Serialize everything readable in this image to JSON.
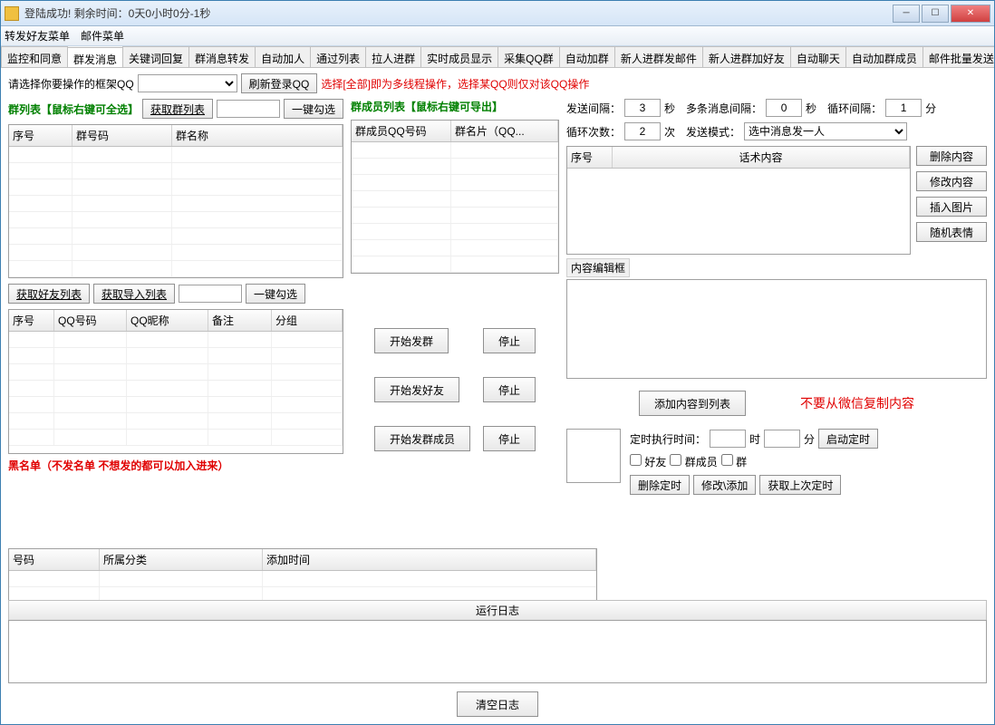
{
  "window": {
    "title": "登陆成功! 剩余时间：0天0小时0分-1秒"
  },
  "menu": {
    "m1": "转发好友菜单",
    "m2": "邮件菜单"
  },
  "tabs": [
    "监控和同意",
    "群发消息",
    "关键词回复",
    "群消息转发",
    "自动加人",
    "通过列表",
    "拉人进群",
    "实时成员显示",
    "采集QQ群",
    "自动加群",
    "新人进群发邮件",
    "新人进群加好友",
    "自动聊天",
    "自动加群成员",
    "邮件批量发送"
  ],
  "top": {
    "label": "请选择你要操作的框架QQ",
    "refresh": "刷新登录QQ",
    "note": "选择[全部]即为多线程操作，选择某QQ则仅对该QQ操作"
  },
  "groupList": {
    "title": "群列表【鼠标右键可全选】",
    "fetch": "获取群列表",
    "checkAll": "一键勾选",
    "cols": {
      "c1": "序号",
      "c2": "群号码",
      "c3": "群名称"
    }
  },
  "memberList": {
    "title": "群成员列表【鼠标右键可导出】",
    "cols": {
      "c1": "群成员QQ号码",
      "c2": "群名片（QQ..."
    }
  },
  "friends": {
    "fetch": "获取好友列表",
    "import": "获取导入列表",
    "checkAll": "一键勾选",
    "cols": {
      "c1": "序号",
      "c2": "QQ号码",
      "c3": "QQ昵称",
      "c4": "备注",
      "c5": "分组"
    }
  },
  "send": {
    "intervalLabel": "发送间隔：",
    "intervalVal": "3",
    "sec": "秒",
    "multiLabel": "多条消息间隔：",
    "multiVal": "0",
    "loopIntervalLabel": "循环间隔：",
    "loopIntervalVal": "1",
    "min": "分",
    "loopCountLabel": "循环次数：",
    "loopCountVal": "2",
    "times": "次",
    "modeLabel": "发送模式：",
    "mode": "选中消息发一人"
  },
  "script": {
    "cols": {
      "c1": "序号",
      "c2": "话术内容"
    },
    "btnDel": "删除内容",
    "btnEdit": "修改内容",
    "btnImg": "插入图片",
    "btnEmoji": "随机表情",
    "editLabel": "内容编辑框",
    "addBtn": "添加内容到列表",
    "warn": "不要从微信复制内容"
  },
  "actions": {
    "startGroup": "开始发群",
    "startFriend": "开始发好友",
    "startMember": "开始发群成员",
    "stop": "停止"
  },
  "blacklist": {
    "title": "黑名单（不发名单 不想发的都可以加入进来）",
    "cols": {
      "c1": "号码",
      "c2": "所属分类",
      "c3": "添加时间"
    }
  },
  "timer": {
    "label": "定时执行时间：",
    "hour": "时",
    "min": "分",
    "start": "启动定时",
    "ck1": "好友",
    "ck2": "群成员",
    "ck3": "群",
    "del": "删除定时",
    "edit": "修改\\添加",
    "last": "获取上次定时"
  },
  "log": {
    "title": "运行日志",
    "clear": "清空日志"
  }
}
